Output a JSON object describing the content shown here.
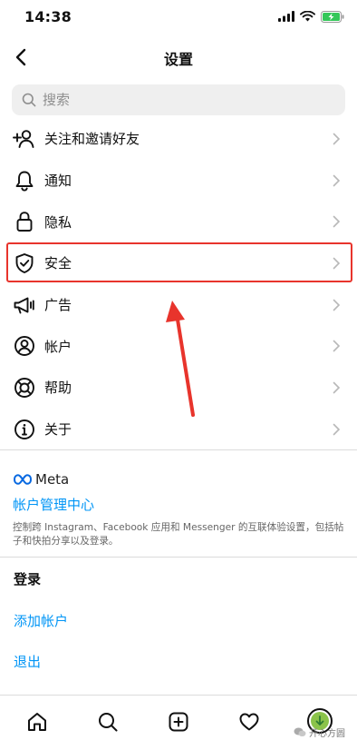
{
  "status_bar": {
    "time": "14:38"
  },
  "header": {
    "title": "设置"
  },
  "search": {
    "placeholder": "搜索"
  },
  "menu": [
    {
      "label": "关注和邀请好友",
      "icon": "add-person-icon"
    },
    {
      "label": "通知",
      "icon": "bell-icon"
    },
    {
      "label": "隐私",
      "icon": "lock-icon"
    },
    {
      "label": "安全",
      "icon": "shield-check-icon"
    },
    {
      "label": "广告",
      "icon": "megaphone-icon"
    },
    {
      "label": "帐户",
      "icon": "user-circle-icon"
    },
    {
      "label": "帮助",
      "icon": "lifebuoy-icon"
    },
    {
      "label": "关于",
      "icon": "info-icon"
    }
  ],
  "meta": {
    "logo_text": "Meta",
    "title": "帐户管理中心",
    "description": "控制跨 Instagram、Facebook 应用和 Messenger 的互联体验设置，包括帖子和快拍分享以及登录。"
  },
  "login": {
    "header": "登录",
    "add_account": "添加帐户",
    "logout": "退出"
  },
  "tab_bar": [
    {
      "name": "home-icon"
    },
    {
      "name": "search-icon"
    },
    {
      "name": "create-post-icon"
    },
    {
      "name": "heart-icon"
    },
    {
      "name": "profile-avatar"
    }
  ],
  "watermark": {
    "text": "开心方圆"
  },
  "colors": {
    "link_blue": "#0095f6",
    "highlight_red": "#e8342c",
    "search_bg": "#efefef"
  }
}
